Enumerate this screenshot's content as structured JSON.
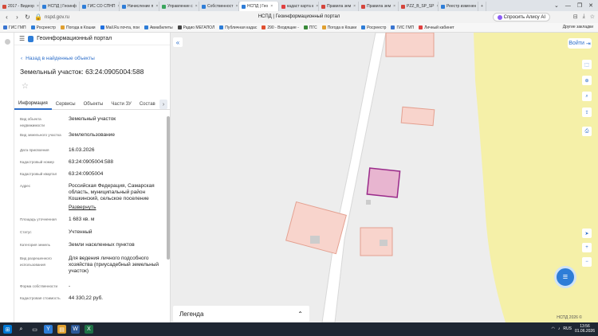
{
  "browser": {
    "tabs": [
      {
        "label": "2017 - Видеор",
        "color": "#d34b3a"
      },
      {
        "label": "НСПД | Геоинф",
        "color": "#2e7dd7"
      },
      {
        "label": "ГИС СО СПНП",
        "color": "#2e7dd7"
      },
      {
        "label": "Начисление п",
        "color": "#2e7dd7"
      },
      {
        "label": "Управление с",
        "color": "#3aa55d"
      },
      {
        "label": "Собственност",
        "color": "#2e7dd7"
      },
      {
        "label": "НСПД | Гео",
        "color": "#2e7dd7"
      },
      {
        "label": "кадаст карта к",
        "color": "#e04040"
      },
      {
        "label": "Правила зем",
        "color": "#d4453b"
      },
      {
        "label": "Правила зем",
        "color": "#d4453b"
      },
      {
        "label": "PZZ_B_SP_SP",
        "color": "#d4453b"
      },
      {
        "label": "Реестр изменен",
        "color": "#2e7dd7"
      }
    ],
    "url": "nspd.gov.ru",
    "page_title": "НСПД | Геоинформационный портал",
    "alice_label": "Спросить Алису AI",
    "bookmarks": [
      {
        "label": "ГИС ГМП",
        "color": "#3a75d0"
      },
      {
        "label": "Росреестр",
        "color": "#2e7dd7"
      },
      {
        "label": "Погода в Кошки",
        "color": "#e0a030"
      },
      {
        "label": "Mail.Ru почта, пои",
        "color": "#2070e0"
      },
      {
        "label": "Авиабилеты",
        "color": "#2e7dd7"
      },
      {
        "label": "Радио МЕГАПОЛ",
        "color": "#444"
      },
      {
        "label": "Публичная кадас",
        "color": "#2e7dd7"
      },
      {
        "label": "290 - Входящие -",
        "color": "#e05030"
      },
      {
        "label": "ПГС",
        "color": "#3a8a3a"
      },
      {
        "label": "Погода в Кошки",
        "color": "#e0a030"
      },
      {
        "label": "Росреестр",
        "color": "#2e7dd7"
      },
      {
        "label": "ГИС ГМП",
        "color": "#3a75d0"
      },
      {
        "label": "Личный кабинет",
        "color": "#e04040"
      }
    ],
    "other_bookmarks": "Другие закладки"
  },
  "portal": {
    "name": "Геоинформационный портал",
    "back_label": "Назад в найденные объекты",
    "object_title": "Земельный участок: 63:24:0905004:588",
    "tabs": [
      "Информация",
      "Сервисы",
      "Объекты",
      "Части ЗУ",
      "Состав"
    ],
    "attributes": [
      {
        "key": "Вид объекта недвижимости",
        "value": "Земельный участок"
      },
      {
        "key": "Вид земельного участка",
        "value": "Землепользование"
      },
      {
        "key": "Дата присвоения",
        "value": "16.03.2026"
      },
      {
        "key": "Кадастровый номер",
        "value": "63:24:0905004:588"
      },
      {
        "key": "Кадастровый квартал",
        "value": "63:24:0905004"
      },
      {
        "key": "Адрес",
        "value": "Российская Федерация, Самарская область, муниципальный район Кошкинский, сельское поселение"
      },
      {
        "key": "Площадь уточненная",
        "value": "1 683 кв. м"
      },
      {
        "key": "Статус",
        "value": "Учтенный"
      },
      {
        "key": "Категория земель",
        "value": "Земли населенных пунктов"
      },
      {
        "key": "Вид разрешенного использования",
        "value": "Для ведения личного подсобного хозяйства (приусадебный земельный участок)"
      },
      {
        "key": "Форма собственности",
        "value": "-"
      },
      {
        "key": "Кадастровая стоимость",
        "value": "44 330,22 руб."
      }
    ],
    "expand_label": "Развернуть"
  },
  "map": {
    "login_label": "Войти",
    "legend_label": "Легенда",
    "copyright": "НСПД 2026 ©"
  },
  "taskbar": {
    "time": "13:56",
    "date": "01.06.2026",
    "lang": "RUS"
  }
}
